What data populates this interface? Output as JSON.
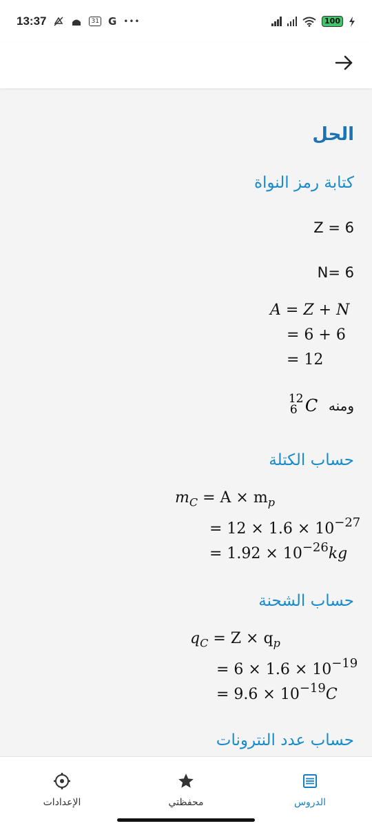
{
  "status_bar": {
    "time": "13:37",
    "calendar_day": "31",
    "g_icon": "G",
    "more": "•••",
    "battery": "100"
  },
  "solution": {
    "title": "الحل",
    "nucleus_title": "كتابة رمز النواة",
    "z_line": "Z = 6",
    "n_line": "N= 6",
    "mass_eq": {
      "line1": {
        "lhs": "A",
        "op": "=",
        "rhs_a": "Z",
        "plus": "+",
        "rhs_b": "N"
      },
      "line2": "= 6 + 6",
      "line3": "= 12"
    },
    "hence": "ومنه",
    "symbol": {
      "mass": "12",
      "atomic": "6",
      "element": "C"
    },
    "mass_title": "حساب الكتلة",
    "mass_calc": {
      "line1": {
        "lhs": "m",
        "lhs_sub": "C",
        "rhs": "= A × m",
        "rhs_sub": "p"
      },
      "line2": {
        "text": "= 12 × 1.6 × 10",
        "exp": "−27"
      },
      "line3": {
        "text": "= 1.92 × 10",
        "exp": "−26",
        "unit": "kg"
      }
    },
    "charge_title": "حساب الشحنة",
    "charge_calc": {
      "line1": {
        "lhs": "q",
        "lhs_sub": "C",
        "rhs": "= Z × q",
        "rhs_sub": "p"
      },
      "line2": {
        "text": "= 6 × 1.6 × 10",
        "exp": "−19"
      },
      "line3": {
        "text": "= 9.6 × 10",
        "exp": "−19",
        "unit": "C"
      }
    },
    "neutrons_title": "حساب عدد النترونات"
  },
  "bottom_nav": {
    "lessons": "الدروس",
    "favorites": "محفظتي",
    "settings": "الإعدادات",
    "active_color": "#1a7fc1"
  },
  "icons": {
    "back": "arrow-right-icon",
    "lessons": "list-icon",
    "favorites": "star-icon",
    "settings": "gear-icon"
  }
}
